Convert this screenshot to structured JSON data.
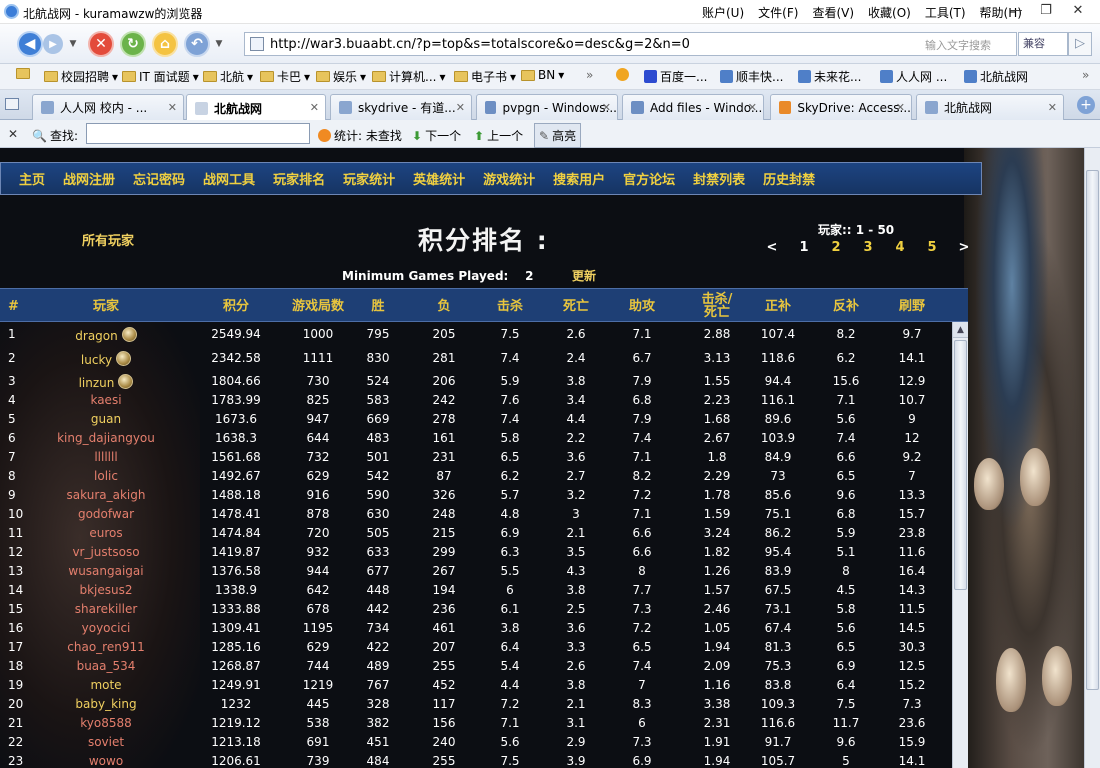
{
  "window": {
    "title": "北航战网 - kuramawzw的浏览器",
    "menus": [
      "账户(U)",
      "文件(F)",
      "查看(V)",
      "收藏(O)",
      "工具(T)",
      "帮助(H)"
    ]
  },
  "address": {
    "url": "http://war3.buaabt.cn/?p=top&s=totalscore&o=desc&g=2&n=0",
    "search_placeholder": "输入文字搜索",
    "compat_label": "兼容"
  },
  "bookmarks": [
    {
      "label": "校园招聘",
      "icon": "folder-icon"
    },
    {
      "label": "IT 面试题",
      "icon": "folder-icon"
    },
    {
      "label": "北航",
      "icon": "folder-icon"
    },
    {
      "label": "卡巴",
      "icon": "folder-icon"
    },
    {
      "label": "娱乐",
      "icon": "folder-icon"
    },
    {
      "label": "计算机...",
      "icon": "folder-icon"
    },
    {
      "label": "电子书",
      "icon": "folder-icon"
    },
    {
      "label": "BN",
      "icon": "folder-icon"
    },
    {
      "label": "百度一...",
      "icon": "baidu-icon"
    },
    {
      "label": "顺丰快...",
      "icon": "page-icon"
    },
    {
      "label": "未来花...",
      "icon": "page-icon"
    },
    {
      "label": "人人网 ...",
      "icon": "page-icon"
    },
    {
      "label": "北航战网",
      "icon": "page-icon"
    }
  ],
  "tabs": [
    {
      "label": "人人网 校内 - ...",
      "active": false
    },
    {
      "label": "北航战网",
      "active": true
    },
    {
      "label": "skydrive - 有道...",
      "active": false
    },
    {
      "label": "pvpgn - Windows...",
      "active": false
    },
    {
      "label": "Add files - Windo...",
      "active": false
    },
    {
      "label": "SkyDrive: Access...",
      "active": false
    },
    {
      "label": "北航战网",
      "active": false
    }
  ],
  "findbar": {
    "find_label": "查找:",
    "find_value": "",
    "stats_label": "统计: 未查找",
    "next_label": "下一个",
    "prev_label": "上一个",
    "highlight_label": "高亮"
  },
  "site_nav": [
    "主页",
    "战网注册",
    "忘记密码",
    "战网工具",
    "玩家排名",
    "玩家统计",
    "英雄统计",
    "游戏统计",
    "搜索用户",
    "官方论坛",
    "封禁列表",
    "历史封禁"
  ],
  "ranking": {
    "filter_label": "所有玩家",
    "title": "积分排名 :",
    "players_range": "玩家:: 1 - 50",
    "pages": [
      "<",
      "1",
      "2",
      "3",
      "4",
      "5",
      ">"
    ],
    "min_games_label": "Minimum Games Played:",
    "min_games_value": "2",
    "refresh_label": "更新",
    "columns": [
      "#",
      "玩家",
      "积分",
      "游戏局数",
      "胜",
      "负",
      "击杀",
      "死亡",
      "助攻",
      "击杀/\n死亡",
      "正补",
      "反补",
      "刷野"
    ],
    "rows": [
      {
        "rank": "1",
        "name": "dragon",
        "medal": true,
        "score": "2549.94",
        "games": "1000",
        "win": "795",
        "loss": "205",
        "kill": "7.5",
        "death": "2.6",
        "assist": "7.1",
        "kd": "2.88",
        "lh": "107.4",
        "deny": "8.2",
        "creep": "9.7"
      },
      {
        "rank": "2",
        "name": "lucky",
        "medal": true,
        "score": "2342.58",
        "games": "1111",
        "win": "830",
        "loss": "281",
        "kill": "7.4",
        "death": "2.4",
        "assist": "6.7",
        "kd": "3.13",
        "lh": "118.6",
        "deny": "6.2",
        "creep": "14.1"
      },
      {
        "rank": "3",
        "name": "linzun",
        "medal": true,
        "score": "1804.66",
        "games": "730",
        "win": "524",
        "loss": "206",
        "kill": "5.9",
        "death": "3.8",
        "assist": "7.9",
        "kd": "1.55",
        "lh": "94.4",
        "deny": "15.6",
        "creep": "12.9"
      },
      {
        "rank": "4",
        "name": "kaesi",
        "medal": false,
        "score": "1783.99",
        "games": "825",
        "win": "583",
        "loss": "242",
        "kill": "7.6",
        "death": "3.4",
        "assist": "6.8",
        "kd": "2.23",
        "lh": "116.1",
        "deny": "7.1",
        "creep": "10.7"
      },
      {
        "rank": "5",
        "name": "guan",
        "medal": false,
        "score": "1673.6",
        "games": "947",
        "win": "669",
        "loss": "278",
        "kill": "7.4",
        "death": "4.4",
        "assist": "7.9",
        "kd": "1.68",
        "lh": "89.6",
        "deny": "5.6",
        "creep": "9"
      },
      {
        "rank": "6",
        "name": "king_dajiangyou",
        "medal": false,
        "score": "1638.3",
        "games": "644",
        "win": "483",
        "loss": "161",
        "kill": "5.8",
        "death": "2.2",
        "assist": "7.4",
        "kd": "2.67",
        "lh": "103.9",
        "deny": "7.4",
        "creep": "12"
      },
      {
        "rank": "7",
        "name": "lllllll",
        "medal": false,
        "score": "1561.68",
        "games": "732",
        "win": "501",
        "loss": "231",
        "kill": "6.5",
        "death": "3.6",
        "assist": "7.1",
        "kd": "1.8",
        "lh": "84.9",
        "deny": "6.6",
        "creep": "9.2"
      },
      {
        "rank": "8",
        "name": "lolic",
        "medal": false,
        "score": "1492.67",
        "games": "629",
        "win": "542",
        "loss": "87",
        "kill": "6.2",
        "death": "2.7",
        "assist": "8.2",
        "kd": "2.29",
        "lh": "73",
        "deny": "6.5",
        "creep": "7"
      },
      {
        "rank": "9",
        "name": "sakura_akigh",
        "medal": false,
        "score": "1488.18",
        "games": "916",
        "win": "590",
        "loss": "326",
        "kill": "5.7",
        "death": "3.2",
        "assist": "7.2",
        "kd": "1.78",
        "lh": "85.6",
        "deny": "9.6",
        "creep": "13.3"
      },
      {
        "rank": "10",
        "name": "godofwar",
        "medal": false,
        "score": "1478.41",
        "games": "878",
        "win": "630",
        "loss": "248",
        "kill": "4.8",
        "death": "3",
        "assist": "7.1",
        "kd": "1.59",
        "lh": "75.1",
        "deny": "6.8",
        "creep": "15.7"
      },
      {
        "rank": "11",
        "name": "euros",
        "medal": false,
        "score": "1474.84",
        "games": "720",
        "win": "505",
        "loss": "215",
        "kill": "6.9",
        "death": "2.1",
        "assist": "6.6",
        "kd": "3.24",
        "lh": "86.2",
        "deny": "5.9",
        "creep": "23.8"
      },
      {
        "rank": "12",
        "name": "vr_justsoso",
        "medal": false,
        "score": "1419.87",
        "games": "932",
        "win": "633",
        "loss": "299",
        "kill": "6.3",
        "death": "3.5",
        "assist": "6.6",
        "kd": "1.82",
        "lh": "95.4",
        "deny": "5.1",
        "creep": "11.6"
      },
      {
        "rank": "13",
        "name": "wusangaigai",
        "medal": false,
        "score": "1376.58",
        "games": "944",
        "win": "677",
        "loss": "267",
        "kill": "5.5",
        "death": "4.3",
        "assist": "8",
        "kd": "1.26",
        "lh": "83.9",
        "deny": "8",
        "creep": "16.4"
      },
      {
        "rank": "14",
        "name": "bkjesus2",
        "medal": false,
        "score": "1338.9",
        "games": "642",
        "win": "448",
        "loss": "194",
        "kill": "6",
        "death": "3.8",
        "assist": "7.7",
        "kd": "1.57",
        "lh": "67.5",
        "deny": "4.5",
        "creep": "14.3"
      },
      {
        "rank": "15",
        "name": "sharekiller",
        "medal": false,
        "score": "1333.88",
        "games": "678",
        "win": "442",
        "loss": "236",
        "kill": "6.1",
        "death": "2.5",
        "assist": "7.3",
        "kd": "2.46",
        "lh": "73.1",
        "deny": "5.8",
        "creep": "11.5"
      },
      {
        "rank": "16",
        "name": "yoyocici",
        "medal": false,
        "score": "1309.41",
        "games": "1195",
        "win": "734",
        "loss": "461",
        "kill": "3.8",
        "death": "3.6",
        "assist": "7.2",
        "kd": "1.05",
        "lh": "67.4",
        "deny": "5.6",
        "creep": "14.5"
      },
      {
        "rank": "17",
        "name": "chao_ren911",
        "medal": false,
        "score": "1285.16",
        "games": "629",
        "win": "422",
        "loss": "207",
        "kill": "6.4",
        "death": "3.3",
        "assist": "6.5",
        "kd": "1.94",
        "lh": "81.3",
        "deny": "6.5",
        "creep": "30.3"
      },
      {
        "rank": "18",
        "name": "buaa_534",
        "medal": false,
        "score": "1268.87",
        "games": "744",
        "win": "489",
        "loss": "255",
        "kill": "5.4",
        "death": "2.6",
        "assist": "7.4",
        "kd": "2.09",
        "lh": "75.3",
        "deny": "6.9",
        "creep": "12.5"
      },
      {
        "rank": "19",
        "name": "mote",
        "medal": false,
        "score": "1249.91",
        "games": "1219",
        "win": "767",
        "loss": "452",
        "kill": "4.4",
        "death": "3.8",
        "assist": "7",
        "kd": "1.16",
        "lh": "83.8",
        "deny": "6.4",
        "creep": "15.2"
      },
      {
        "rank": "20",
        "name": "baby_king",
        "medal": false,
        "score": "1232",
        "games": "445",
        "win": "328",
        "loss": "117",
        "kill": "7.2",
        "death": "2.1",
        "assist": "8.3",
        "kd": "3.38",
        "lh": "109.3",
        "deny": "7.5",
        "creep": "7.3"
      },
      {
        "rank": "21",
        "name": "kyo8588",
        "medal": false,
        "score": "1219.12",
        "games": "538",
        "win": "382",
        "loss": "156",
        "kill": "7.1",
        "death": "3.1",
        "assist": "6",
        "kd": "2.31",
        "lh": "116.6",
        "deny": "11.7",
        "creep": "23.6"
      },
      {
        "rank": "22",
        "name": "soviet",
        "medal": false,
        "score": "1213.18",
        "games": "691",
        "win": "451",
        "loss": "240",
        "kill": "5.6",
        "death": "2.9",
        "assist": "7.3",
        "kd": "1.91",
        "lh": "91.7",
        "deny": "9.6",
        "creep": "15.9"
      },
      {
        "rank": "23",
        "name": "wowo",
        "medal": false,
        "score": "1206.61",
        "games": "739",
        "win": "484",
        "loss": "255",
        "kill": "7.5",
        "death": "3.9",
        "assist": "6.9",
        "kd": "1.94",
        "lh": "105.7",
        "deny": "5",
        "creep": "14.1"
      }
    ]
  },
  "colors": {
    "nav_text": "#f0d040",
    "header_bg": "#1e3f75",
    "name_gold": "#f0d060",
    "name_red": "#e47f6d"
  }
}
